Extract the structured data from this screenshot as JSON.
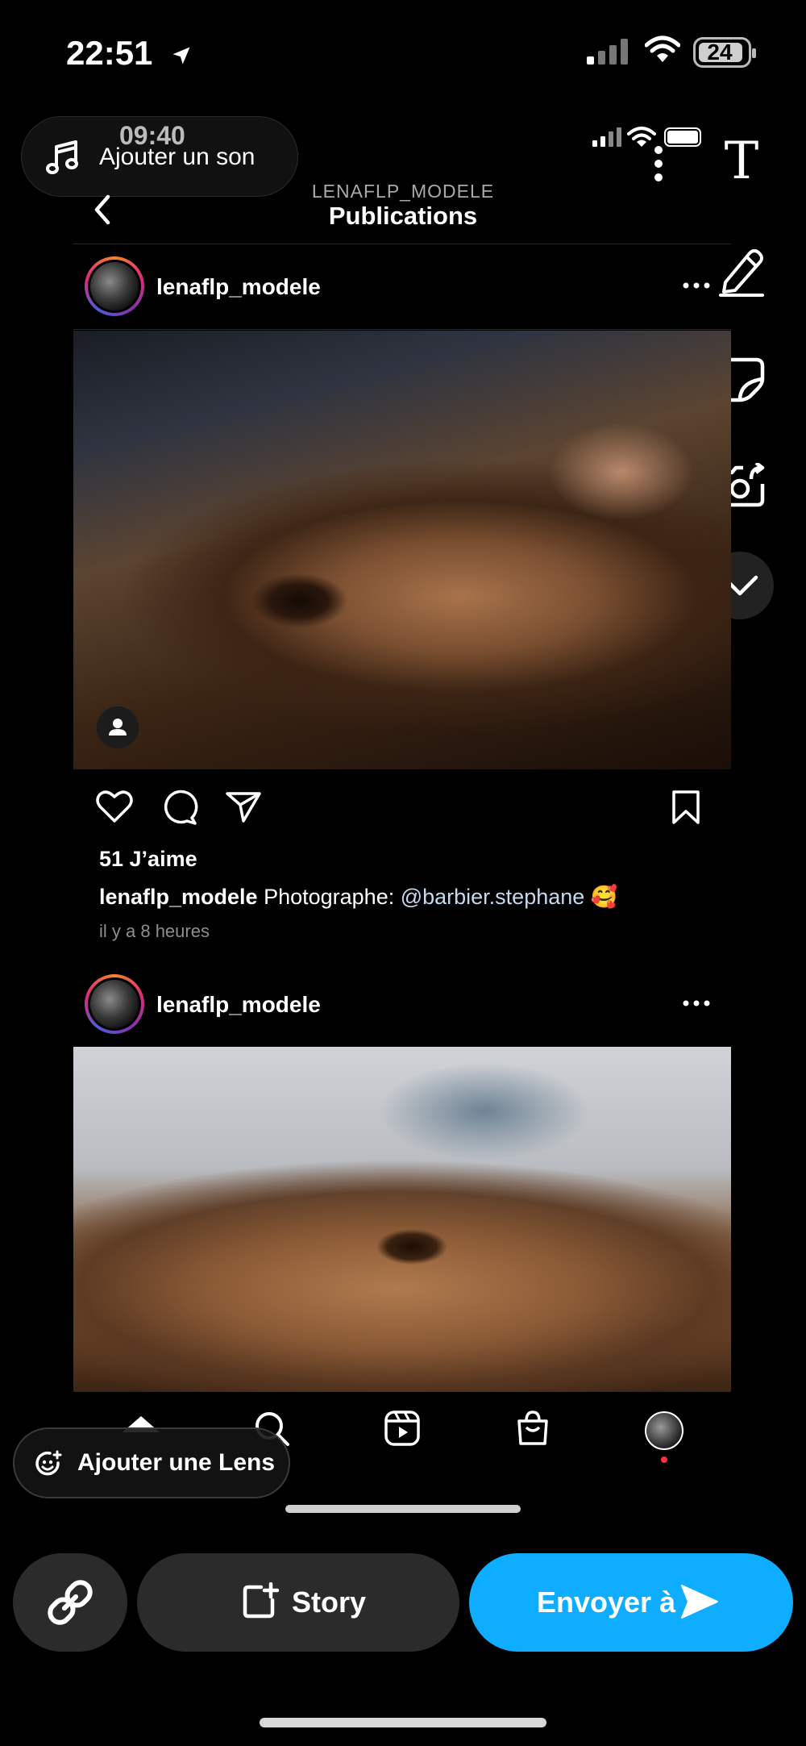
{
  "status_bar": {
    "time": "22:51",
    "battery": "24"
  },
  "sound": {
    "inner_time": "09:40",
    "label": "Ajouter un son"
  },
  "ig_header": {
    "username": "LENAFLP_MODELE",
    "title": "Publications"
  },
  "posts": [
    {
      "username": "lenaflp_modele",
      "likes": "51 J’aime",
      "caption_user": "lenaflp_modele",
      "caption_text": "Photographe: ",
      "caption_mention": "@barbier.stephane",
      "caption_emoji": "🥰",
      "time_ago": "il y a 8 heures"
    },
    {
      "username": "lenaflp_modele"
    }
  ],
  "lens": {
    "label": "Ajouter une Lens"
  },
  "share_bar": {
    "story_label": "Story",
    "send_label": "Envoyer à"
  },
  "tools": {
    "text_tool": "T"
  },
  "icons": [
    "location-arrow-icon",
    "signal-icon",
    "wifi-icon",
    "battery-icon",
    "music-note-icon",
    "more-vertical-icon",
    "text-icon",
    "pencil-icon",
    "sticker-icon",
    "camera-flip-icon",
    "chevron-down-icon",
    "back-chevron-icon",
    "more-horizontal-icon",
    "person-icon",
    "heart-icon",
    "comment-icon",
    "share-icon",
    "bookmark-icon",
    "home-icon",
    "search-icon",
    "reels-icon",
    "shop-icon",
    "lens-icon",
    "link-icon",
    "add-story-icon",
    "send-arrow-icon"
  ],
  "colors": {
    "accent": "#0eadff",
    "background": "#000000",
    "mention": "#c5d9ef",
    "muted": "#8e8e8e"
  }
}
